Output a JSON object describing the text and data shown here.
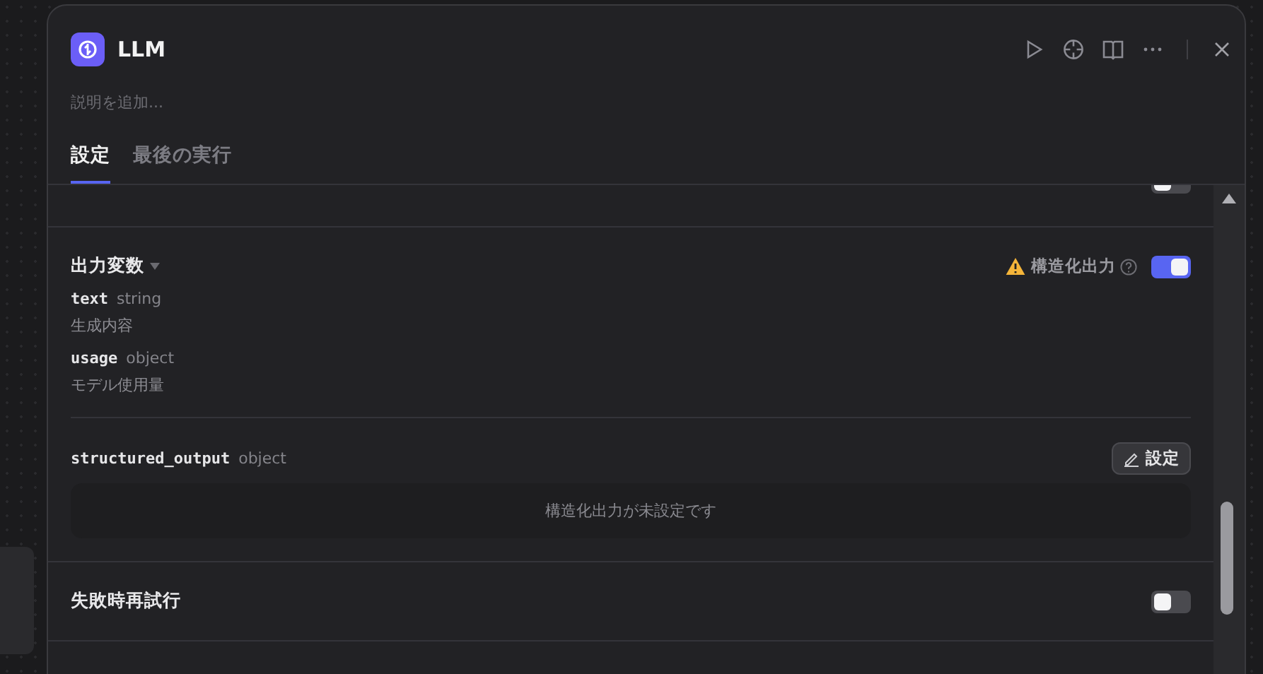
{
  "panel": {
    "title": "LLM",
    "description_placeholder": "説明を追加..."
  },
  "tabs": [
    {
      "label": "設定",
      "selected": true
    },
    {
      "label": "最後の実行",
      "selected": false
    }
  ],
  "top_row": {
    "on": false
  },
  "output_variables": {
    "title": "出力変数",
    "structured_label": "構造化出力",
    "structured_on": true,
    "warning": true,
    "variables": [
      {
        "name": "text",
        "type": "string",
        "description": "生成内容"
      },
      {
        "name": "usage",
        "type": "object",
        "description": "モデル使用量"
      }
    ]
  },
  "structured_output": {
    "name": "structured_output",
    "type": "object",
    "button": "設定",
    "empty_message": "構造化出力が未設定です"
  },
  "retry": {
    "label": "失敗時再試行",
    "on": false
  }
}
